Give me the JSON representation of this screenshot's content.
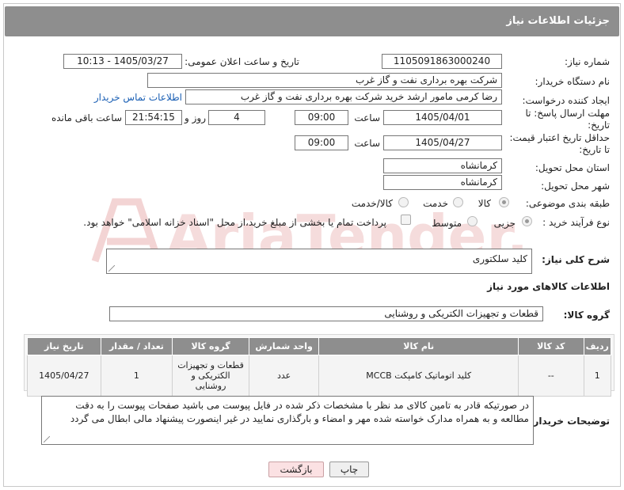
{
  "header": {
    "title": "جزئیات اطلاعات نیاز"
  },
  "form": {
    "need_number": {
      "label": "شماره نیاز:",
      "value": "1105091863000240"
    },
    "announce_datetime": {
      "label": "تاریخ و ساعت اعلان عمومی:",
      "value": "1405/03/27 - 10:13"
    },
    "buyer_org": {
      "label": "نام دستگاه خریدار:",
      "value": "شرکت بهره برداری نفت و گاز غرب"
    },
    "requester": {
      "label": "ایجاد کننده درخواست:",
      "value": "رضا کرمی مامور ارشد خرید شرکت بهره برداری نفت و گاز غرب",
      "contact_link": "اطلاعات تماس خریدار"
    },
    "reply_deadline": {
      "label_line1": "مهلت ارسال پاسخ: تا",
      "label_line2": "تاریخ:",
      "date": "1405/04/01",
      "time_label": "ساعت",
      "time": "09:00",
      "days": "4",
      "days_label": "روز و",
      "remaining_time": "21:54:15",
      "remaining_label": "ساعت باقی مانده"
    },
    "price_validity": {
      "label_line1": "حداقل تاریخ اعتبار قیمت:",
      "label_line2": "تا تاریخ:",
      "date": "1405/04/27",
      "time_label": "ساعت",
      "time": "09:00"
    },
    "delivery_province": {
      "label": "استان محل تحویل:",
      "value": "کرمانشاه"
    },
    "delivery_city": {
      "label": "شهر محل تحویل:",
      "value": "کرمانشاه"
    },
    "category": {
      "label": "طبقه بندی موضوعی:",
      "options": [
        "کالا",
        "خدمت",
        "کالا/خدمت"
      ],
      "selected": "کالا"
    },
    "purchase_process": {
      "label": "نوع فرآیند خرید :",
      "options": [
        "جزیی",
        "متوسط"
      ],
      "selected": "جزیی",
      "payment_note": "پرداخت تمام یا بخشی از مبلغ خرید،از محل \"اسناد خزانه اسلامی\" خواهد بود."
    }
  },
  "need_description": {
    "label": "شرح کلی نیاز:",
    "value": "کلید سلکتوری"
  },
  "goods_section": {
    "title": "اطلاعات کالاهای مورد نیاز"
  },
  "goods_group": {
    "label": "گروه کالا:",
    "value": "قطعات و تجهیزات الکتریکی و روشنایی"
  },
  "table": {
    "headers": [
      "ردیف",
      "کد کالا",
      "نام کالا",
      "واحد شمارش",
      "گروه کالا",
      "تعداد / مقدار",
      "تاریخ نیاز"
    ],
    "rows": [
      [
        "1",
        "--",
        "کلید اتوماتیک کامپکت MCCB",
        "عدد",
        "قطعات و تجهیزات الکتریکی و روشنایی",
        "1",
        "1405/04/27"
      ]
    ]
  },
  "buyer_notes": {
    "label": "توضیحات خریدار:",
    "value": "در صورتیکه قادر به تامین کالای مد نظر با مشخصات ذکر شده در فایل پیوست می باشید صفحات پیوست را به دقت مطالعه و به همراه مدارک خواسته شده مهر و امضاء و بارگذاری نمایید در غیر اینصورت پیشنهاد مالی ابطال می گردد"
  },
  "buttons": {
    "print": "چاپ",
    "back": "بازگشت"
  },
  "watermark": {
    "text": "AriaTender.neT"
  },
  "colors": {
    "header_bg": "#8e8e8e",
    "link": "#1a5fb4",
    "back_button": "#fbe1e3",
    "watermark": "#f3d6d6"
  }
}
